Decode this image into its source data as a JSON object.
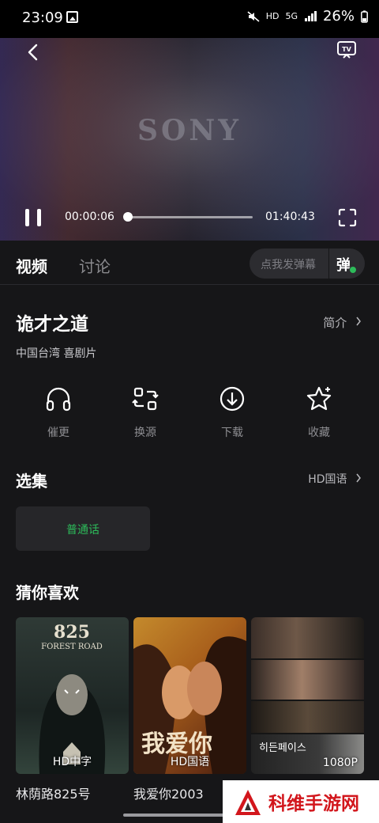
{
  "status_bar": {
    "time": "23:09",
    "hd": "HD",
    "net": "5G",
    "battery": "26%"
  },
  "player": {
    "logo": "SONY",
    "current_time": "00:00:06",
    "total_time": "01:40:43",
    "progress": 0.001
  },
  "tabs": {
    "video": "视频",
    "discussion": "讨论"
  },
  "danmu": {
    "placeholder": "点我发弹幕",
    "button": "弹"
  },
  "show": {
    "title": "诡才之道",
    "intro_label": "简介",
    "meta": "中国台湾  喜剧片"
  },
  "actions": [
    {
      "label": "催更",
      "icon": "headphones-icon"
    },
    {
      "label": "换源",
      "icon": "switch-source-icon"
    },
    {
      "label": "下载",
      "icon": "download-icon"
    },
    {
      "label": "收藏",
      "icon": "star-icon"
    }
  ],
  "episodes": {
    "title": "选集",
    "quality": "HD国语",
    "chip": "普通话"
  },
  "recommend": {
    "title": "猜你喜欢",
    "items": [
      {
        "name": "林荫路825号",
        "quality": "HD中字",
        "poster_text": "825",
        "poster_sub": "FOREST ROAD"
      },
      {
        "name": "我爱你2003",
        "quality": "HD国语",
        "poster_text": "我爱你"
      },
      {
        "name": "",
        "quality": "1080P",
        "poster_text": "히든페이스"
      }
    ]
  },
  "watermark": {
    "text": "科维手游网"
  },
  "colors": {
    "accent_green": "#2dbb5a",
    "background": "#161618",
    "watermark_red": "#d2161c"
  }
}
